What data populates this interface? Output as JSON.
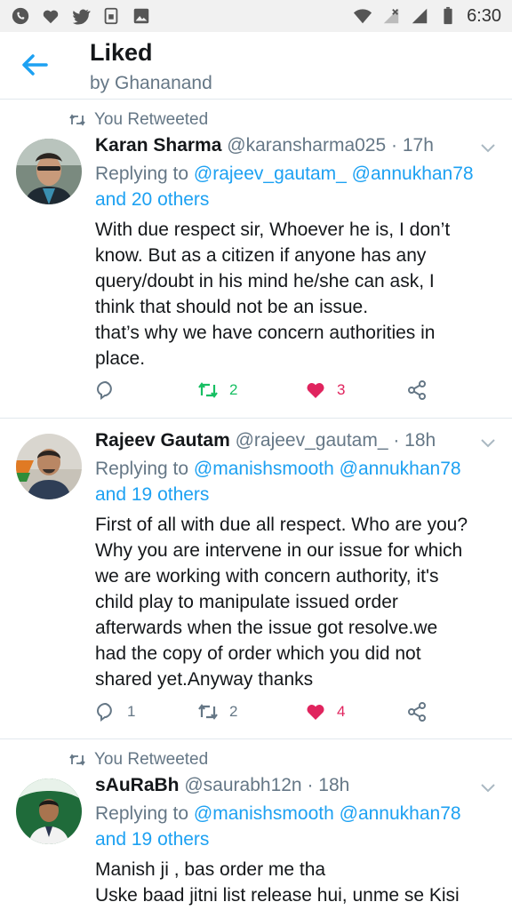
{
  "status_bar": {
    "time": "6:30",
    "icons": [
      "whatsapp-icon",
      "heart-icon",
      "twitter-icon",
      "sim-icon",
      "image-icon",
      "wifi-icon",
      "signal-icon",
      "battery-icon"
    ]
  },
  "header": {
    "title": "Liked",
    "subtitle": "by Ghananand",
    "back_icon": "arrow-left-icon"
  },
  "colors": {
    "link": "#1da1f2",
    "retweet": "#17bf63",
    "like": "#e0245e",
    "secondary": "#657786"
  },
  "tweets": [
    {
      "retweet_label": "You Retweeted",
      "name": "Karan Sharma",
      "handle": "@karansharma025",
      "time": "· 17h",
      "replying_prefix": "Replying to",
      "replying_links": "@rajeev_gautam_ @annukhan78",
      "replying_more": "and 20 others",
      "lines": [
        "With due respect sir, Whoever he is, I don’t",
        "know. But as a citizen if anyone has any",
        "query/doubt in his mind he/she can ask, I",
        "think that should not be an issue.",
        "that’s why we have concern authorities in",
        "place."
      ],
      "replies": "",
      "retweets": "2",
      "likes": "3"
    },
    {
      "retweet_label": "",
      "name": "Rajeev Gautam",
      "handle": "@rajeev_gautam_",
      "time": "· 18h",
      "replying_prefix": "Replying to",
      "replying_links": "@manishsmooth @annukhan78",
      "replying_more": "and 19 others",
      "lines": [
        "First of all with due all respect. Who are you?",
        "Why you are intervene in our issue for which",
        "we are working with concern authority, it's",
        "child play to manipulate issued order",
        "afterwards when the issue got resolve.we",
        "had the copy of order which you did not",
        "shared yet.Anyway thanks"
      ],
      "replies": "1",
      "retweets": "2",
      "likes": "4"
    },
    {
      "retweet_label": "You Retweeted",
      "name": "sAuRaBh",
      "handle": "@saurabh12n",
      "time": "· 18h",
      "replying_prefix": "Replying to",
      "replying_links": "@manishsmooth @annukhan78",
      "replying_more": "and 19 others",
      "lines": [
        "Manish ji , bas order me tha",
        " Uske baad jitni list release hui, unme se Kisi"
      ]
    }
  ]
}
